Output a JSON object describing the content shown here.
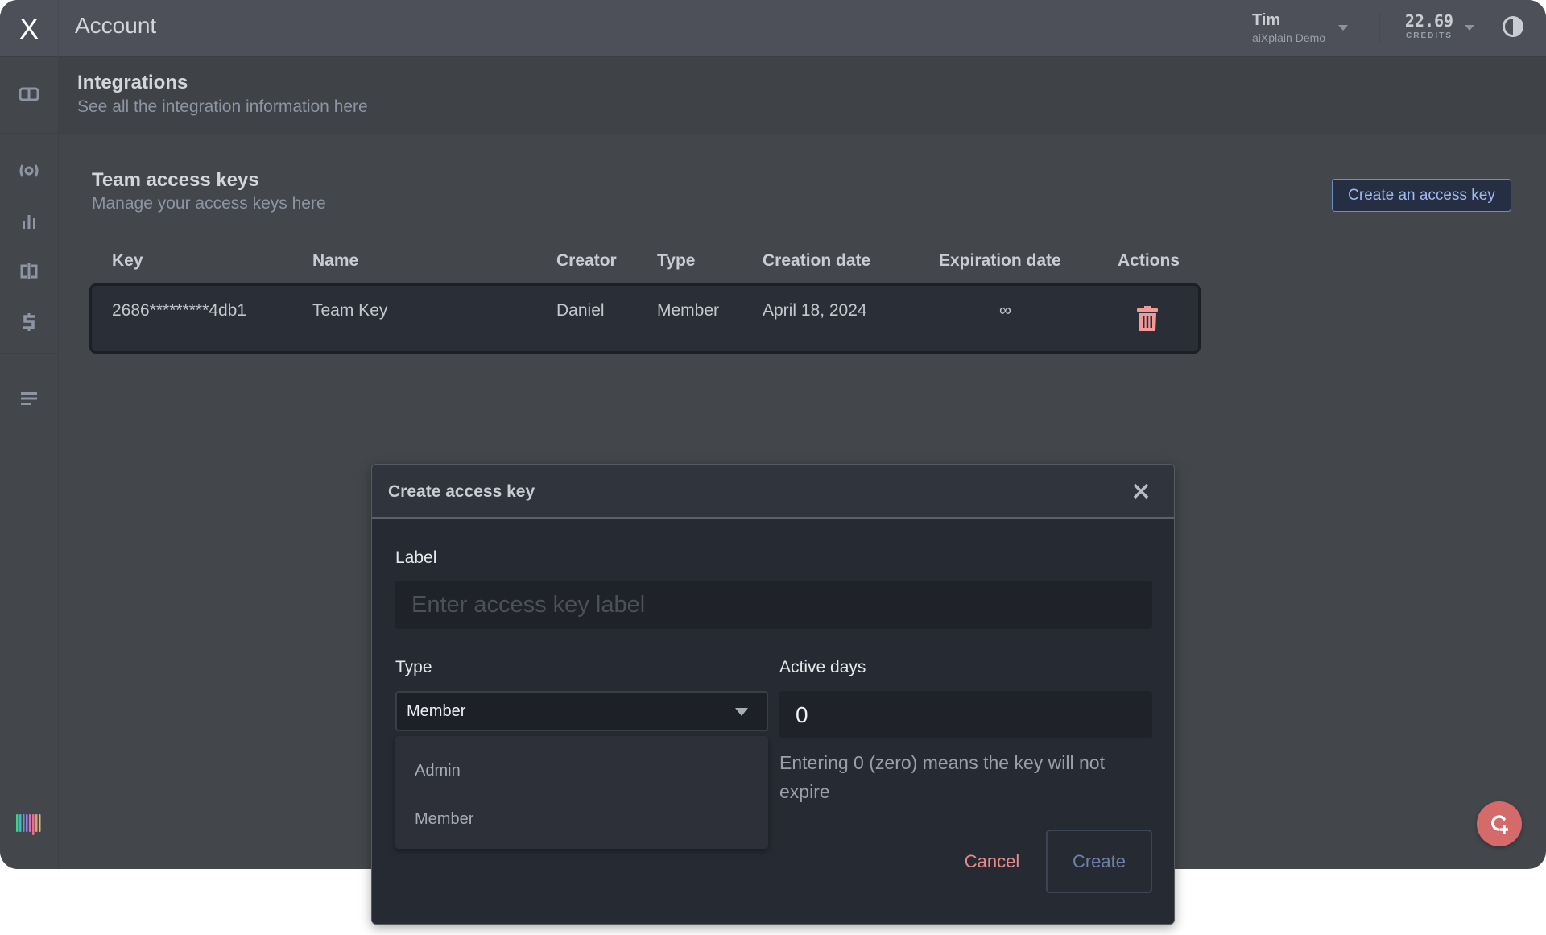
{
  "topbar": {
    "logo": "X",
    "title": "Account",
    "user": {
      "name": "Tim",
      "org": "aiXplain Demo"
    },
    "credits": {
      "value": "22.69",
      "label": "CREDITS"
    }
  },
  "sidebar": {
    "items": [
      {
        "icon": "dashboard-icon"
      },
      {
        "icon": "broadcast-icon"
      },
      {
        "icon": "bar-chart-icon"
      },
      {
        "icon": "split-icon"
      },
      {
        "icon": "billing-icon"
      },
      {
        "icon": "list-icon"
      }
    ]
  },
  "subheader": {
    "title": "Integrations",
    "description": "See all the integration information here"
  },
  "section": {
    "title": "Team access keys",
    "description": "Manage your access keys here",
    "create_button": "Create an access key"
  },
  "table": {
    "columns": [
      "Key",
      "Name",
      "Creator",
      "Type",
      "Creation date",
      "Expiration date",
      "Actions"
    ],
    "rows": [
      {
        "key": "2686*********4db1",
        "name": "Team Key",
        "creator": "Daniel",
        "type": "Member",
        "creation_date": "April 18, 2024",
        "expiration_date": "∞"
      }
    ]
  },
  "modal": {
    "title": "Create access key",
    "label_field": {
      "label": "Label",
      "placeholder": "Enter access key label",
      "value": ""
    },
    "type_field": {
      "label": "Type",
      "value": "Member",
      "options": [
        "Admin",
        "Member"
      ]
    },
    "days_field": {
      "label": "Active days",
      "value": "0",
      "hint": "Entering 0 (zero) means the key will not expire"
    },
    "cancel": "Cancel",
    "create": "Create"
  },
  "colors": {
    "accent": "#9fbaf0",
    "danger": "#e88a8a",
    "fab": "#d46a6a"
  }
}
